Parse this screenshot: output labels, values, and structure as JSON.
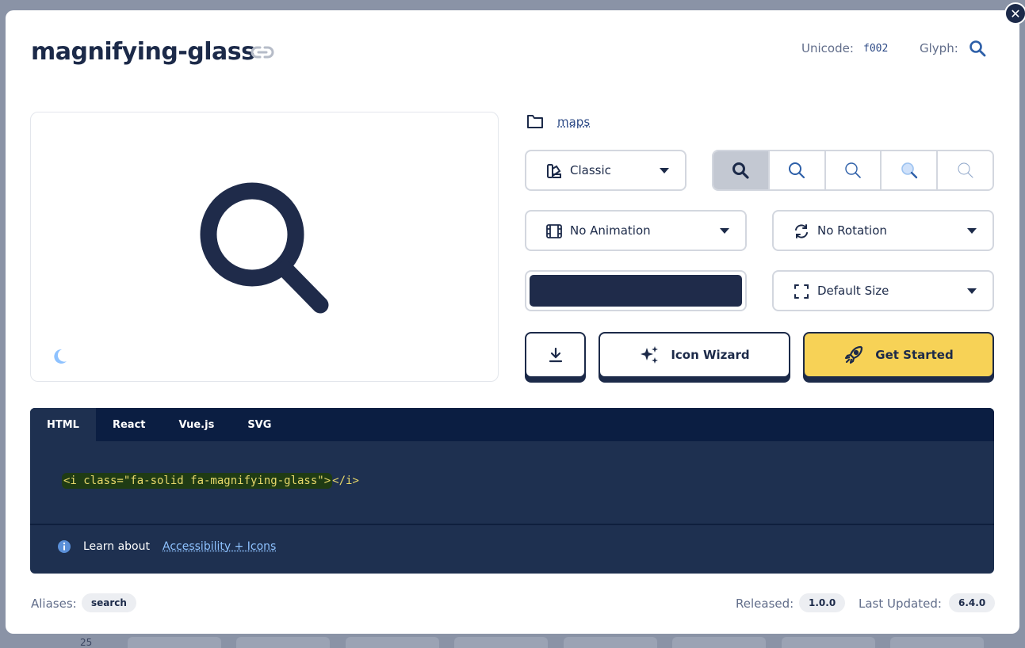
{
  "header": {
    "title": "magnifying-glass",
    "unicode_label": "Unicode:",
    "unicode_value": "f002",
    "glyph_label": "Glyph:"
  },
  "category": {
    "label": "maps"
  },
  "controls": {
    "family_select": "Classic",
    "animation_select": "No Animation",
    "rotation_select": "No Rotation",
    "size_select": "Default Size",
    "color_value": "#1f2b4a",
    "style_variants": [
      "solid",
      "regular",
      "light",
      "duotone",
      "thin"
    ],
    "active_style": "solid"
  },
  "actions": {
    "wizard_label": "Icon Wizard",
    "get_started_label": "Get Started"
  },
  "code": {
    "tabs": [
      "HTML",
      "React",
      "Vue.js",
      "SVG"
    ],
    "active_tab": "HTML",
    "snippet_open": "<i class=\"fa-solid fa-magnifying-glass\">",
    "snippet_close": "</i>",
    "learn_label": "Learn about",
    "a11y_link": "Accessibility + Icons"
  },
  "footer": {
    "aliases_label": "Aliases:",
    "alias": "search",
    "released_label": "Released:",
    "released_value": "1.0.0",
    "updated_label": "Last Updated:",
    "updated_value": "6.4.0"
  },
  "backdrop": {
    "number": "25"
  },
  "colors": {
    "navy": "#1c2a49",
    "accent_yellow": "#f7d256",
    "link_blue": "#2d4a86",
    "code_bg": "#1e3050",
    "tab_bar": "#0b1e42"
  }
}
